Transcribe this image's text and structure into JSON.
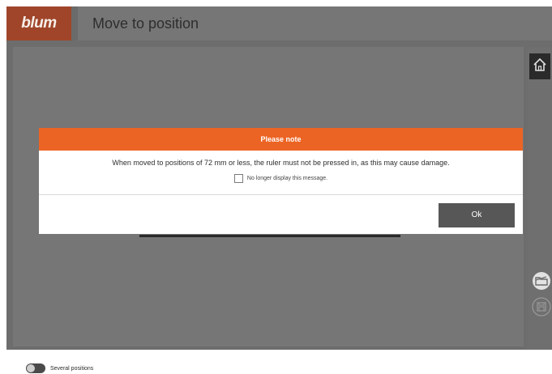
{
  "header": {
    "logo_text": "blum",
    "title": "Move to position"
  },
  "colors": {
    "brand": "#a0452a",
    "dialog_accent": "#ec6424",
    "ok_button": "#575757"
  },
  "dialog": {
    "title": "Please note",
    "message": "When moved to positions of 72 mm or less, the ruler must not be pressed in, as this may cause damage.",
    "checkbox_label": "No longer display this message.",
    "checkbox_checked": false,
    "ok_label": "Ok"
  },
  "sidebar": {
    "icons": [
      "home-icon",
      "open-folder-icon",
      "save-icon"
    ]
  },
  "footer": {
    "toggle_label": "Several positions",
    "toggle_on": false
  }
}
